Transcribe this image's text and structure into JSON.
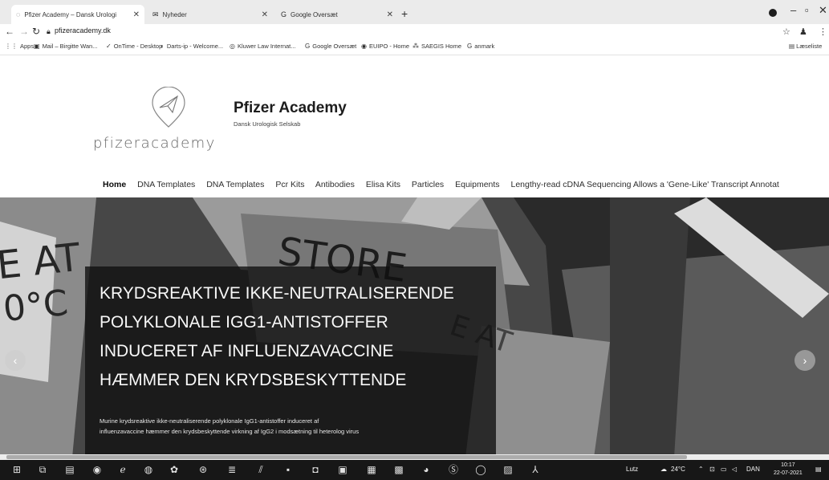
{
  "browser": {
    "tabs": [
      {
        "label": "Pfizer Academy – Dansk Urologi",
        "active": true
      },
      {
        "label": "Nyheder",
        "active": false
      },
      {
        "label": "Google Oversæt",
        "active": false
      }
    ],
    "url": "pfizeracademy.dk",
    "bookmarks": [
      "Apps",
      "Mail – Birgitte Wan...",
      "OnTime - Desktop",
      "Darts-ip - Welcome...",
      "Kluwer Law Internat...",
      "Google Oversæt",
      "EUIPO - Home",
      "SAEGIS Home",
      "anmark"
    ],
    "reading_list": "Læseliste"
  },
  "site": {
    "logo_text": "pfizeracademy",
    "title": "Pfizer Academy",
    "tagline": "Dansk Urologisk Selskab"
  },
  "nav": [
    "Home",
    "DNA Templates",
    "DNA Templates",
    "Pcr Kits",
    "Antibodies",
    "Elisa Kits",
    "Particles",
    "Equipments",
    "Lengthy-read cDNA Sequencing Allows a 'Gene-Like' Transcript Annotat"
  ],
  "hero": {
    "bg_text_left": "E AT",
    "bg_text_left2": "0°C",
    "bg_text_mid": "STORE",
    "bg_text_mid2": "E AT",
    "title_lines": [
      "KRYDSREAKTIVE IKKE-NEUTRALISERENDE",
      "POLYKLONALE IGG1-ANTISTOFFER",
      "INDUCERET AF INFLUENZAVACCINE",
      "HÆMMER DEN KRYDSBESKYTTENDE"
    ],
    "body_lines": [
      "Murine krydsreaktive ikke-neutraliserende polyklonale IgG1-antistoffer induceret af",
      "influenzavaccine hæmmer den krydsbeskyttende virkning af IgG2 i modsætning til heterolog virus"
    ]
  },
  "taskbar": {
    "tray_location": "Lutz",
    "weather": "24°C",
    "language": "DAN",
    "time": "10:17",
    "date": "22-07-2021"
  }
}
